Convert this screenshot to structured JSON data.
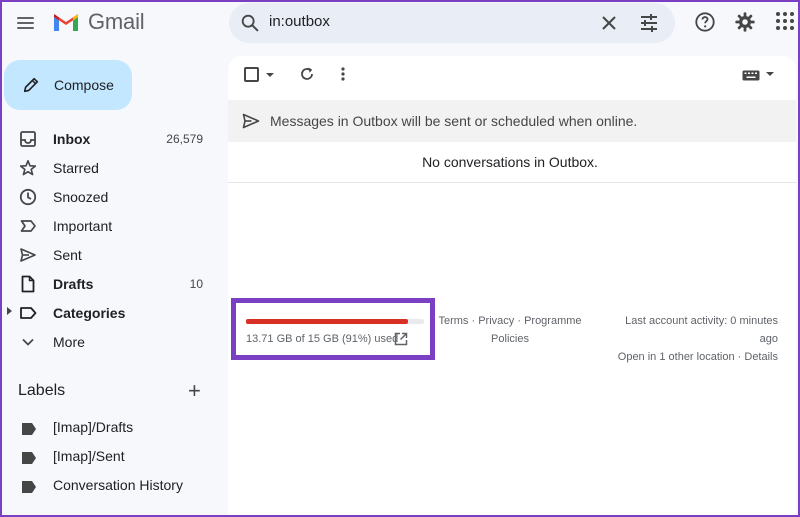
{
  "app": {
    "logo_text": "Gmail"
  },
  "search": {
    "value": "in:outbox"
  },
  "compose": {
    "label": "Compose"
  },
  "nav": {
    "items": [
      {
        "label": "Inbox",
        "count": "26,579"
      },
      {
        "label": "Starred"
      },
      {
        "label": "Snoozed"
      },
      {
        "label": "Important"
      },
      {
        "label": "Sent"
      },
      {
        "label": "Drafts",
        "count": "10"
      },
      {
        "label": "Categories"
      },
      {
        "label": "More"
      }
    ]
  },
  "labels": {
    "title": "Labels",
    "add": "+",
    "items": [
      {
        "label": "[Imap]/Drafts"
      },
      {
        "label": "[Imap]/Sent"
      },
      {
        "label": "Conversation History"
      }
    ]
  },
  "main": {
    "banner": "Messages in Outbox will be sent or scheduled when online.",
    "empty": "No conversations in Outbox."
  },
  "storage": {
    "text": "13.71 GB of 15 GB (91%) used",
    "used_fraction": 0.91,
    "bar_color": "#d93025"
  },
  "footer": {
    "terms": "Terms",
    "privacy": "Privacy",
    "programme": "Programme",
    "policies": "Policies",
    "sep": "·",
    "activity_line1": "Last account activity: 0 minutes",
    "activity_line2": "ago",
    "open_location": "Open in 1 other location",
    "details": "Details"
  },
  "colors": {
    "accent": "#c2e7ff",
    "highlight_border": "#7b3fc4"
  }
}
